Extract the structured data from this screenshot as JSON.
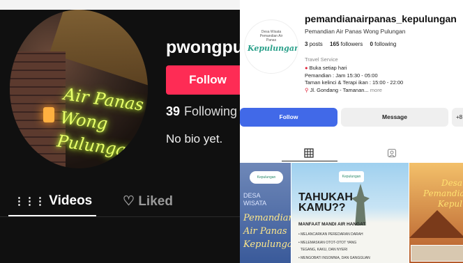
{
  "tiktok": {
    "username": "pwongpu",
    "follow_label": "Follow",
    "following_count": "39",
    "following_label": "Following",
    "bio": "No bio yet.",
    "tabs": {
      "videos": "Videos",
      "liked": "Liked"
    },
    "avatar_neon_text": "Air Panas Wong Pulungan"
  },
  "instagram": {
    "username": "pemandianairpanas_kepulungan",
    "display_name": "Pemandian Air Panas Wong Pulungan",
    "avatar_text_small": "Desa Wisata Pemandian Air Panas",
    "avatar_text_logo": "Kepulungan",
    "stats": {
      "posts": "3",
      "posts_label": "posts",
      "followers": "165",
      "followers_label": "followers",
      "following": "0",
      "following_label": "following"
    },
    "category": "Travel Service",
    "bio_lines": [
      "Buka setiap hari",
      "Pemandian : Jam 15:30 - 05:00",
      "Taman kelinci & Terapi ikan : 15:00 - 22:00",
      "Jl. Gondang - Tamanan..."
    ],
    "bio_more": "more",
    "buttons": {
      "follow": "Follow",
      "message": "Message",
      "add": "+8"
    },
    "posts": [
      {
        "logo": "Kepulungan",
        "line1": "DESA",
        "line2": "WISATA",
        "title": [
          "Pemandian",
          "Air Panas",
          "Kepulungan"
        ]
      },
      {
        "logo": "Kepulungan",
        "headline": [
          "TAHUKAH",
          "KAMU??"
        ],
        "subhead": "MANFAAT MANDI AIR HANGAT",
        "items": [
          "MELANCARKAN PEREDARAN DARAH",
          "MELEMASKAN OTOT-OTOT YANG",
          "TEGANG, KAKU, DAN NYERI",
          "MENGOBATI INSOMNIA, DAN GANGGUAN"
        ]
      },
      {
        "title": [
          "Desa",
          "Pemandian",
          "Kepul"
        ]
      }
    ]
  },
  "colors": {
    "tiktok_bg": "#101010",
    "tiktok_red": "#fe2c55",
    "ig_blue": "#4169e8"
  }
}
